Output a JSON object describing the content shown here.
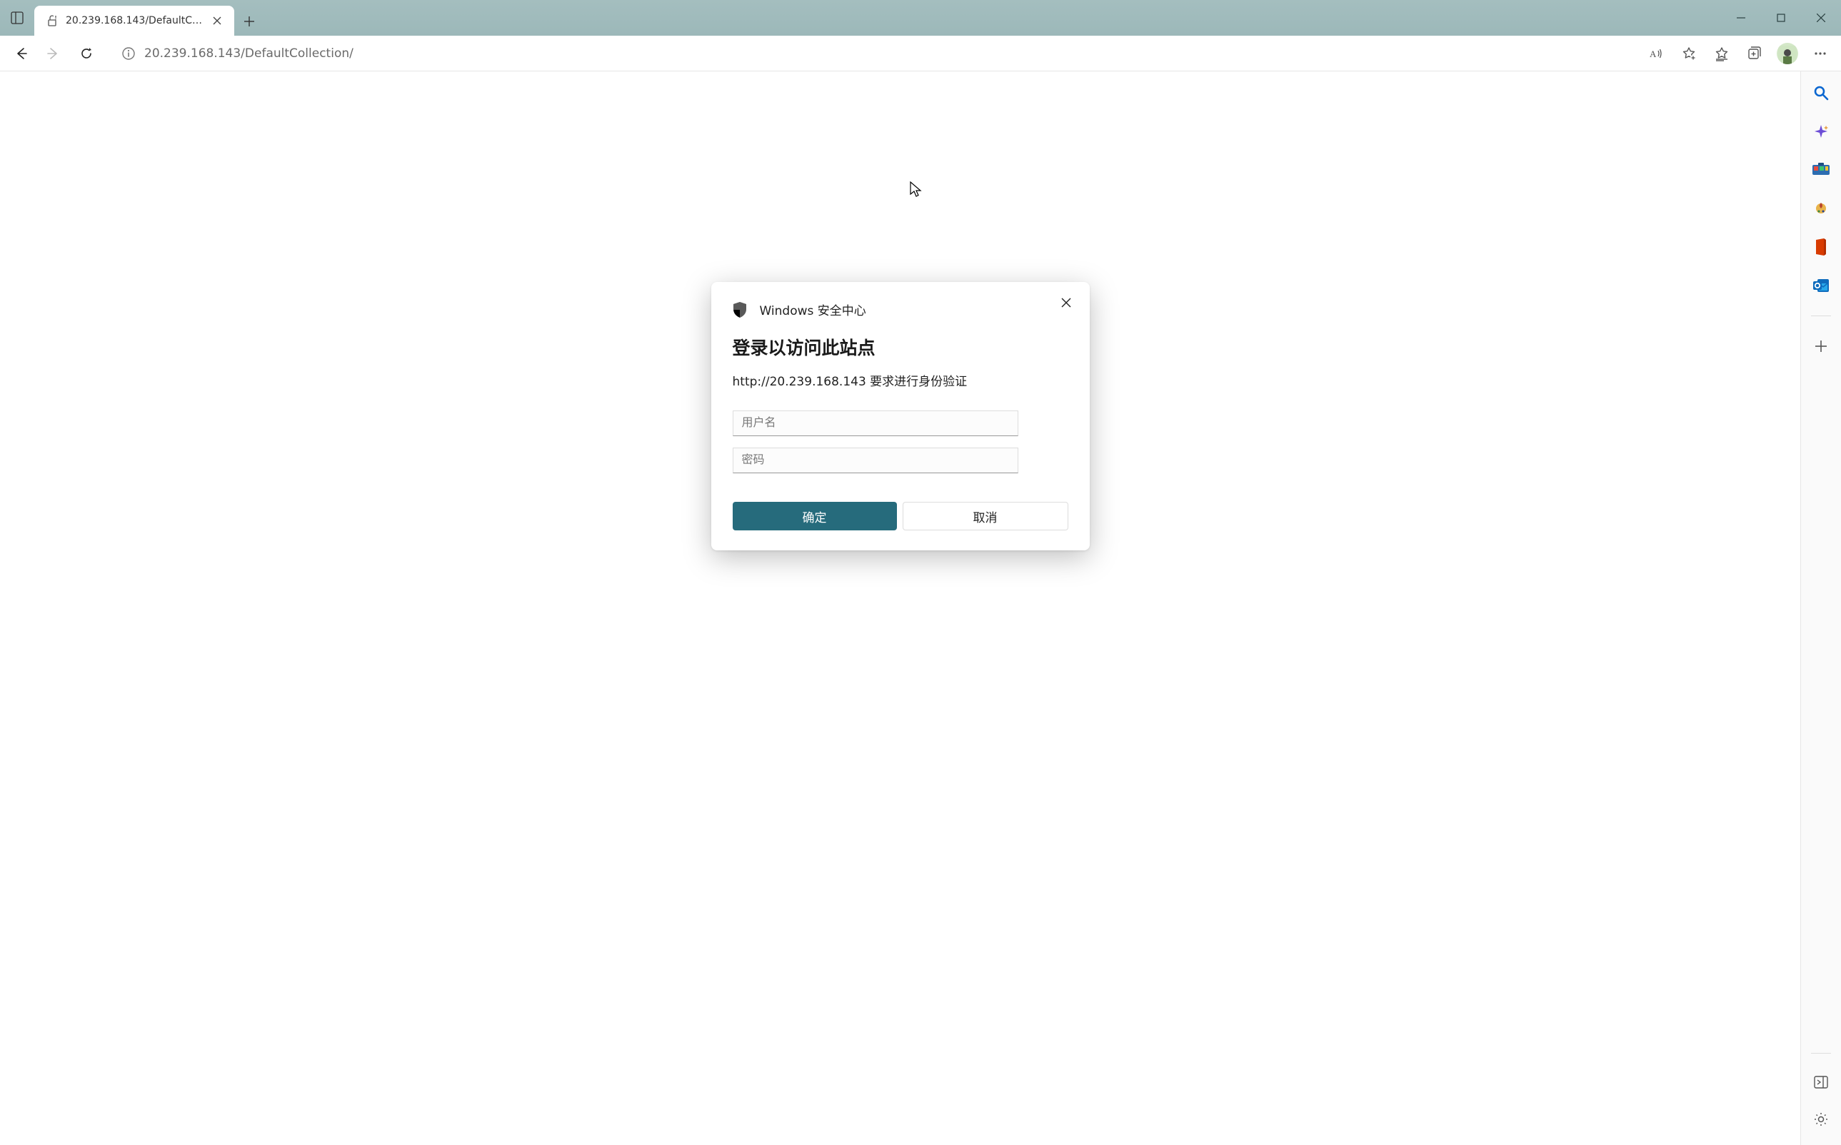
{
  "window": {
    "minimize": "–",
    "maximize": "□",
    "close": "×"
  },
  "tab": {
    "title": "20.239.168.143/DefaultCollection"
  },
  "toolbar": {
    "url": "20.239.168.143/DefaultCollection/"
  },
  "dialog": {
    "brand": "Windows 安全中心",
    "title": "登录以访问此站点",
    "subtitle": "http://20.239.168.143 要求进行身份验证",
    "username_placeholder": "用户名",
    "password_placeholder": "密码",
    "ok_label": "确定",
    "cancel_label": "取消"
  },
  "sidebar": {
    "items": [
      "search",
      "copilot",
      "tools",
      "games",
      "office",
      "outlook"
    ]
  }
}
